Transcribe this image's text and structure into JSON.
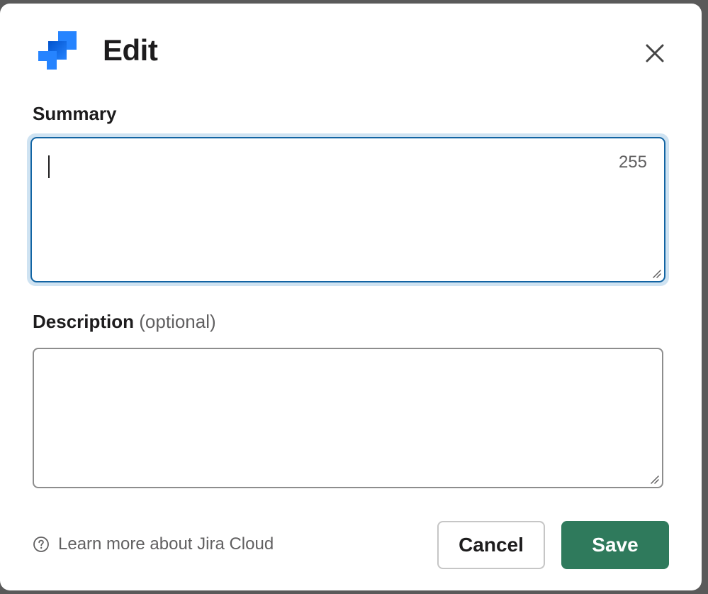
{
  "dialog": {
    "title": "Edit"
  },
  "summary": {
    "label": "Summary",
    "value": "",
    "char_count": "255"
  },
  "description": {
    "label": "Description",
    "optional_label": "(optional)",
    "value": ""
  },
  "footer": {
    "help_link": "Learn more about Jira Cloud",
    "cancel_label": "Cancel",
    "save_label": "Save"
  },
  "icons": {
    "logo": "jira-logo-icon",
    "close": "close-icon",
    "help": "question-circle-icon",
    "resize": "resize-grip-icon"
  },
  "colors": {
    "accent_focus": "#1264a3",
    "focus_ring": "#cfe3f2",
    "save_button": "#2f7a5c",
    "jira_blue": "#2684ff"
  }
}
